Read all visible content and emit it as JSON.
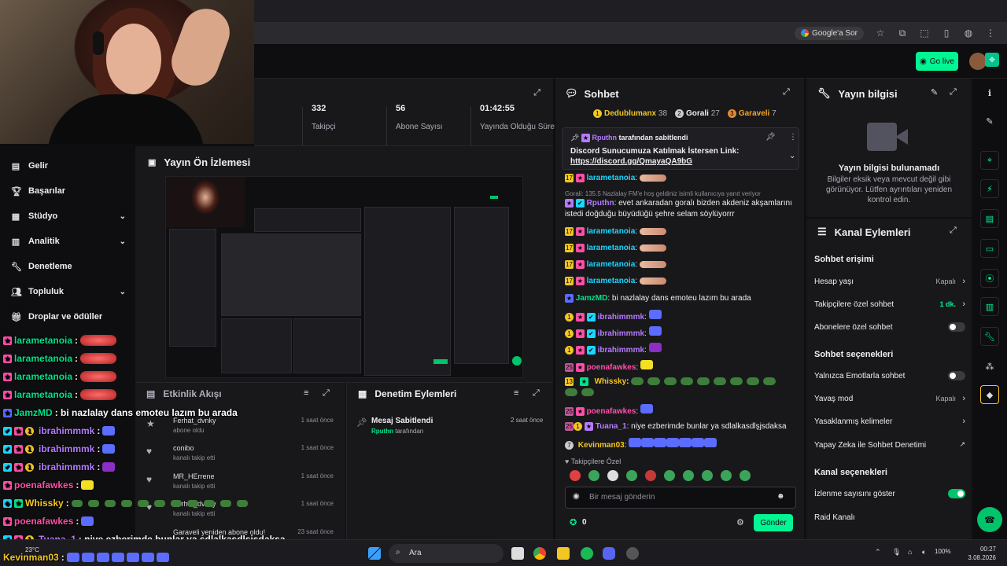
{
  "browser": {
    "google_pill": "Google'a Sor"
  },
  "topnav": {
    "go_live": "Go live"
  },
  "sidebar": {
    "items": [
      {
        "label": "Gelir",
        "icon": "income-icon"
      },
      {
        "label": "Başarılar",
        "icon": "trophy-icon"
      },
      {
        "label": "Stüdyo",
        "icon": "studio-icon",
        "chevron": "⌄"
      },
      {
        "label": "Analitik",
        "icon": "analytics-icon",
        "chevron": "⌄"
      },
      {
        "label": "Denetleme",
        "icon": "wrench-icon"
      },
      {
        "label": "Topluluk",
        "icon": "community-icon",
        "chevron": "⌄"
      },
      {
        "label": "Droplar ve ödüller",
        "icon": "drops-icon"
      }
    ]
  },
  "overlay_chat": [
    {
      "name": "larametanoia",
      "sep": " :"
    },
    {
      "name": "larametanoia",
      "sep": " :"
    },
    {
      "name": "larametanoia",
      "sep": " :"
    },
    {
      "name": "larametanoia",
      "sep": " :"
    },
    {
      "name": "JamzMD",
      "text": " : bi nazlalay dans emoteu lazım bu arada"
    },
    {
      "name": "ibrahimmmk",
      "sep": " :"
    },
    {
      "name": "ibrahimmmk",
      "sep": " :"
    },
    {
      "name": "ibrahimmmk",
      "sep": " :"
    },
    {
      "name": "poenafawkes",
      "sep": " :"
    },
    {
      "name": "Whissky",
      "sep": " :"
    },
    {
      "name": "poenafawkes",
      "sep": " :"
    },
    {
      "name": "Tuana_1",
      "text": " : niye ezberimde bunlar ya sdlalkasdlşjsdaksa"
    },
    {
      "name": "Kevinman03",
      "sep": " :"
    }
  ],
  "stats": {
    "followers_num": "332",
    "followers_lbl": "Takipçi",
    "subs_num": "56",
    "subs_lbl": "Abone Sayısı",
    "uptime_num": "01:42:55",
    "uptime_lbl": "Yayında Olduğu Süre"
  },
  "preview": {
    "title": "Yayın Ön İzlemesi"
  },
  "activity": {
    "title": "Etkinlik Akışı",
    "rows": [
      {
        "name": "Ferhat_dvnky",
        "sub": "abone oldu",
        "time": "1 saat önce"
      },
      {
        "name": "conibo",
        "sub": "kanalı takip etti",
        "time": "1 saat önce"
      },
      {
        "name": "MR_HErrene",
        "sub": "kanalı takip etti",
        "time": "1 saat önce"
      },
      {
        "name": "Ferhat_dvnky",
        "sub": "kanalı takip etti",
        "time": "1 saat önce"
      },
      {
        "name": "Garaveli yeniden abone oldu!",
        "sub": "",
        "time": "23 saat önce"
      }
    ]
  },
  "modactions": {
    "title": "Denetim Eylemleri",
    "item_title": "Mesaj Sabitlendi",
    "item_user": "Rputhn",
    "item_suffix": " tarafından",
    "item_time": "2 saat önce"
  },
  "chat": {
    "title": "Sohbet",
    "leaders": [
      {
        "rank": "1",
        "name": "Dedublumanx",
        "count": "38",
        "color": "#f3c623"
      },
      {
        "rank": "2",
        "name": "Gorali",
        "count": "27",
        "color": "#efeff1"
      },
      {
        "rank": "3",
        "name": "Garaveli",
        "count": "7",
        "color": "#f3a623"
      }
    ],
    "pinned_by_user": "Rputhn",
    "pinned_by_suffix": " tarafından sabitlendi",
    "pinned_text": "Discord Sunucumuza Katılmak İstersen Link:",
    "pinned_link": "https://discord.gg/QmayaQA9bG",
    "lines": {
      "l1": "larametanoia",
      "reply": "Gorali: 135.5 Nazlalay FM'e hoş geldiniz isimli kullanıcıya yanıt veriyor",
      "l2_name": "Rputhn",
      "l2_text": ": evet ankaradan goralı bizden akdeniz akşamlarını istedi doğduğu büyüdüğü şehre selam söylüyorrr",
      "l3": "larametanoia",
      "l4": "larametanoia",
      "l5": "larametanoia",
      "l6": "larametanoia",
      "l7_name": "JamzMD",
      "l7_text": ": bi nazlalay dans emoteu lazım bu arada",
      "l8": "ibrahimmmk",
      "l9": "ibrahimmmk",
      "l10": "ibrahimmmk",
      "l11": "poenafawkes",
      "l12": "Whissky",
      "l13": "poenafawkes",
      "l14_name": "Tuana_1",
      "l14_text": ": niye ezberimde bunlar ya sdlalkasdlşjsdaksa",
      "l15": "Kevinman03",
      "colon": ":"
    },
    "followers_only": "Takipçilere Özel",
    "input_placeholder": "Bir mesaj gönderin",
    "points": "0",
    "send": "Gönder"
  },
  "streaminfo": {
    "title": "Yayın bilgisi",
    "empty_title": "Yayın bilgisi bulunamadı",
    "empty_text": "Bilgiler eksik veya mevcut değil gibi görünüyor. Lütfen ayrıntıları yeniden kontrol edin."
  },
  "channelactions": {
    "title": "Kanal Eylemleri",
    "sec_access": "Sohbet erişimi",
    "account_age": "Hesap yaşı",
    "account_age_val": "Kapalı",
    "followers_chat": "Takipçilere özel sohbet",
    "followers_chat_val": "1 dk.",
    "subs_chat": "Abonelere özel sohbet",
    "sec_options": "Sohbet seçenekleri",
    "emote_only": "Yalnızca Emotlarla sohbet",
    "slow_mode": "Yavaş mod",
    "slow_mode_val": "Kapalı",
    "banned_words": "Yasaklanmış kelimeler",
    "ai_mod": "Yapay Zeka ile Sohbet Denetimi",
    "sec_channel": "Kanal seçenekleri",
    "show_views": "İzlenme sayısını göster",
    "raid": "Raid Kanalı"
  },
  "taskbar": {
    "search": "Ara",
    "weather": "23°C",
    "time": "00:27",
    "date": "3.08.2026",
    "battery": "100%"
  },
  "colors": {
    "accent": "#00f593",
    "panel": "#18181b",
    "bg": "#0e0e10"
  }
}
